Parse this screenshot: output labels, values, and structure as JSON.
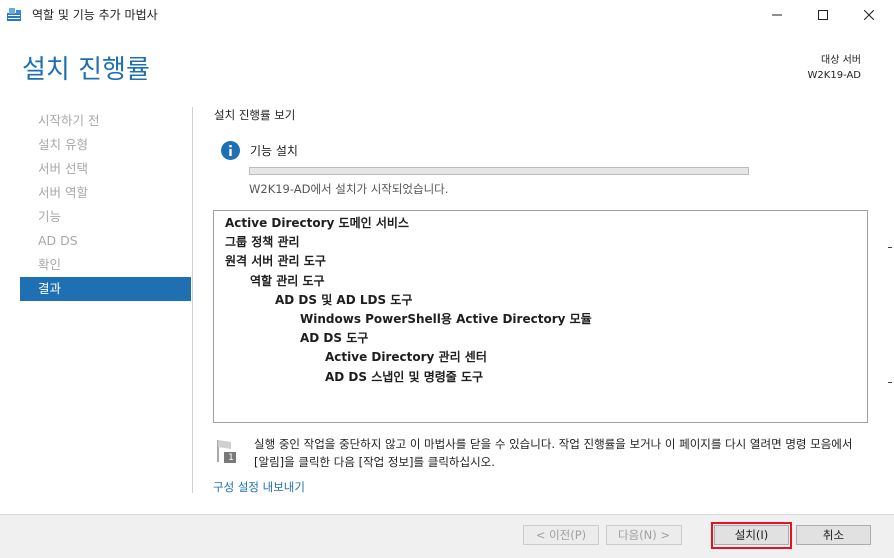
{
  "window": {
    "title": "역할 및 기능 추가 마법사",
    "controls": [
      "minimize-icon",
      "maximize-icon",
      "close-icon"
    ]
  },
  "header": {
    "title": "설치 진행률",
    "target_server_label": "대상 서버",
    "target_server_name": "W2K19-AD"
  },
  "nav": {
    "items": [
      {
        "label": "시작하기 전",
        "active": false
      },
      {
        "label": "설치 유형",
        "active": false
      },
      {
        "label": "서버 선택",
        "active": false
      },
      {
        "label": "서버 역할",
        "active": false
      },
      {
        "label": "기능",
        "active": false
      },
      {
        "label": "AD DS",
        "active": false
      },
      {
        "label": "확인",
        "active": false
      },
      {
        "label": "결과",
        "active": true
      }
    ]
  },
  "content": {
    "section_title": "설치 진행률 보기",
    "install_label": "기능 설치",
    "progress_percent": 0,
    "status_text": "W2K19-AD에서 설치가 시작되었습니다.",
    "features": [
      {
        "text": "Active Directory 도메인 서비스",
        "level": 0
      },
      {
        "text": "그룹 정책 관리",
        "level": 0
      },
      {
        "text": "원격 서버 관리 도구",
        "level": 0
      },
      {
        "text": "역할 관리 도구",
        "level": 1
      },
      {
        "text": "AD DS 및 AD LDS 도구",
        "level": 2
      },
      {
        "text": "Windows PowerShell용 Active Directory 모듈",
        "level": 3
      },
      {
        "text": "AD DS 도구",
        "level": 3
      },
      {
        "text": "Active Directory 관리 센터",
        "level": 4
      },
      {
        "text": "AD DS 스냅인 및 명령줄 도구",
        "level": 4
      }
    ],
    "note_text": "실행 중인 작업을 중단하지 않고 이 마법사를 닫을 수 있습니다. 작업 진행률을 보거나 이 페이지를 다시 열려면 명령 모음에서 [알림]을 클릭한 다음 [작업 정보]를 클릭하십시오.",
    "notification_count": "1",
    "export_link": "구성 설정 내보내기"
  },
  "footer": {
    "prev_label": "< 이전(P)",
    "next_label": "다음(N) >",
    "install_label": "설치(I)",
    "cancel_label": "취소"
  },
  "colors": {
    "accent": "#1f6fb3",
    "highlight": "#e81123"
  }
}
